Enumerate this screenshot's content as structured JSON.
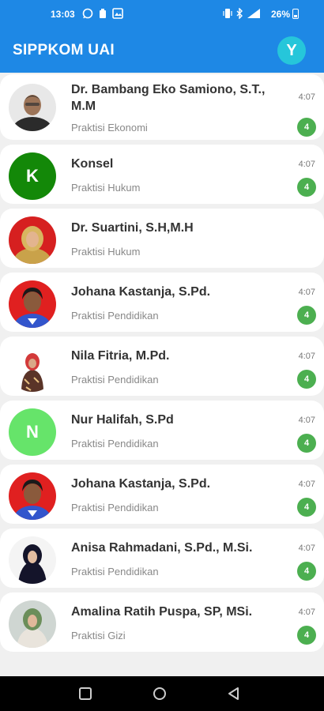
{
  "status_bar": {
    "time": "13:03",
    "battery": "26%",
    "left_icons": [
      "whatsapp-icon",
      "notification-icon",
      "gallery-icon"
    ],
    "right_icons": [
      "vibrate-icon",
      "bluetooth-icon",
      "signal-icon"
    ]
  },
  "app_bar": {
    "title": "SIPPKOM UAI",
    "profile_initial": "Y",
    "profile_color": "#26c6da"
  },
  "theme": {
    "primary": "#1e88e5",
    "badge": "#4caf50"
  },
  "contacts": [
    {
      "name": "Dr. Bambang Eko Samiono, S.T., M.M",
      "subtitle": "Praktisi Ekonomi",
      "time": "4:07",
      "badge": "4",
      "avatar_type": "photo"
    },
    {
      "name": "Konsel",
      "subtitle": "Praktisi Hukum",
      "time": "4:07",
      "badge": "4",
      "avatar_type": "letter",
      "initial": "K",
      "avatar_color": "#138808"
    },
    {
      "name": "Dr. Suartini, S.H,M.H",
      "subtitle": "Praktisi Hukum",
      "time": "",
      "badge": "",
      "avatar_type": "photo"
    },
    {
      "name": "Johana Kastanja, S.Pd.",
      "subtitle": "Praktisi Pendidikan",
      "time": "4:07",
      "badge": "4",
      "avatar_type": "photo"
    },
    {
      "name": "Nila Fitria, M.Pd.",
      "subtitle": "Praktisi Pendidikan",
      "time": "4:07",
      "badge": "4",
      "avatar_type": "photo"
    },
    {
      "name": "Nur Halifah, S.Pd",
      "subtitle": "Praktisi Pendidikan",
      "time": "4:07",
      "badge": "4",
      "avatar_type": "letter",
      "initial": "N",
      "avatar_color": "#66e46a"
    },
    {
      "name": "Johana Kastanja, S.Pd.",
      "subtitle": "Praktisi Pendidikan",
      "time": "4:07",
      "badge": "4",
      "avatar_type": "photo"
    },
    {
      "name": "Anisa Rahmadani, S.Pd., M.Si.",
      "subtitle": "Praktisi Pendidikan",
      "time": "4:07",
      "badge": "4",
      "avatar_type": "photo"
    },
    {
      "name": "Amalina Ratih Puspa, SP, MSi.",
      "subtitle": "Praktisi Gizi",
      "time": "4:07",
      "badge": "4",
      "avatar_type": "photo"
    }
  ],
  "nav_bar": {
    "buttons": [
      "recents-icon",
      "home-icon",
      "back-icon"
    ]
  }
}
